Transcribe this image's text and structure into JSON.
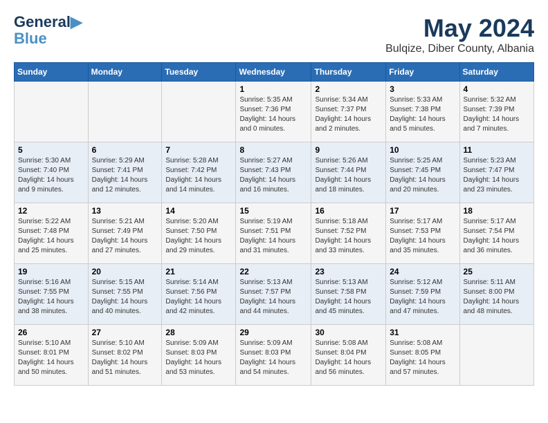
{
  "logo": {
    "line1": "General",
    "line2": "Blue"
  },
  "title": "May 2024",
  "location": "Bulqize, Diber County, Albania",
  "days_of_week": [
    "Sunday",
    "Monday",
    "Tuesday",
    "Wednesday",
    "Thursday",
    "Friday",
    "Saturday"
  ],
  "weeks": [
    [
      {
        "day": "",
        "info": ""
      },
      {
        "day": "",
        "info": ""
      },
      {
        "day": "",
        "info": ""
      },
      {
        "day": "1",
        "info": "Sunrise: 5:35 AM\nSunset: 7:36 PM\nDaylight: 14 hours\nand 0 minutes."
      },
      {
        "day": "2",
        "info": "Sunrise: 5:34 AM\nSunset: 7:37 PM\nDaylight: 14 hours\nand 2 minutes."
      },
      {
        "day": "3",
        "info": "Sunrise: 5:33 AM\nSunset: 7:38 PM\nDaylight: 14 hours\nand 5 minutes."
      },
      {
        "day": "4",
        "info": "Sunrise: 5:32 AM\nSunset: 7:39 PM\nDaylight: 14 hours\nand 7 minutes."
      }
    ],
    [
      {
        "day": "5",
        "info": "Sunrise: 5:30 AM\nSunset: 7:40 PM\nDaylight: 14 hours\nand 9 minutes."
      },
      {
        "day": "6",
        "info": "Sunrise: 5:29 AM\nSunset: 7:41 PM\nDaylight: 14 hours\nand 12 minutes."
      },
      {
        "day": "7",
        "info": "Sunrise: 5:28 AM\nSunset: 7:42 PM\nDaylight: 14 hours\nand 14 minutes."
      },
      {
        "day": "8",
        "info": "Sunrise: 5:27 AM\nSunset: 7:43 PM\nDaylight: 14 hours\nand 16 minutes."
      },
      {
        "day": "9",
        "info": "Sunrise: 5:26 AM\nSunset: 7:44 PM\nDaylight: 14 hours\nand 18 minutes."
      },
      {
        "day": "10",
        "info": "Sunrise: 5:25 AM\nSunset: 7:45 PM\nDaylight: 14 hours\nand 20 minutes."
      },
      {
        "day": "11",
        "info": "Sunrise: 5:23 AM\nSunset: 7:47 PM\nDaylight: 14 hours\nand 23 minutes."
      }
    ],
    [
      {
        "day": "12",
        "info": "Sunrise: 5:22 AM\nSunset: 7:48 PM\nDaylight: 14 hours\nand 25 minutes."
      },
      {
        "day": "13",
        "info": "Sunrise: 5:21 AM\nSunset: 7:49 PM\nDaylight: 14 hours\nand 27 minutes."
      },
      {
        "day": "14",
        "info": "Sunrise: 5:20 AM\nSunset: 7:50 PM\nDaylight: 14 hours\nand 29 minutes."
      },
      {
        "day": "15",
        "info": "Sunrise: 5:19 AM\nSunset: 7:51 PM\nDaylight: 14 hours\nand 31 minutes."
      },
      {
        "day": "16",
        "info": "Sunrise: 5:18 AM\nSunset: 7:52 PM\nDaylight: 14 hours\nand 33 minutes."
      },
      {
        "day": "17",
        "info": "Sunrise: 5:17 AM\nSunset: 7:53 PM\nDaylight: 14 hours\nand 35 minutes."
      },
      {
        "day": "18",
        "info": "Sunrise: 5:17 AM\nSunset: 7:54 PM\nDaylight: 14 hours\nand 36 minutes."
      }
    ],
    [
      {
        "day": "19",
        "info": "Sunrise: 5:16 AM\nSunset: 7:55 PM\nDaylight: 14 hours\nand 38 minutes."
      },
      {
        "day": "20",
        "info": "Sunrise: 5:15 AM\nSunset: 7:55 PM\nDaylight: 14 hours\nand 40 minutes."
      },
      {
        "day": "21",
        "info": "Sunrise: 5:14 AM\nSunset: 7:56 PM\nDaylight: 14 hours\nand 42 minutes."
      },
      {
        "day": "22",
        "info": "Sunrise: 5:13 AM\nSunset: 7:57 PM\nDaylight: 14 hours\nand 44 minutes."
      },
      {
        "day": "23",
        "info": "Sunrise: 5:13 AM\nSunset: 7:58 PM\nDaylight: 14 hours\nand 45 minutes."
      },
      {
        "day": "24",
        "info": "Sunrise: 5:12 AM\nSunset: 7:59 PM\nDaylight: 14 hours\nand 47 minutes."
      },
      {
        "day": "25",
        "info": "Sunrise: 5:11 AM\nSunset: 8:00 PM\nDaylight: 14 hours\nand 48 minutes."
      }
    ],
    [
      {
        "day": "26",
        "info": "Sunrise: 5:10 AM\nSunset: 8:01 PM\nDaylight: 14 hours\nand 50 minutes."
      },
      {
        "day": "27",
        "info": "Sunrise: 5:10 AM\nSunset: 8:02 PM\nDaylight: 14 hours\nand 51 minutes."
      },
      {
        "day": "28",
        "info": "Sunrise: 5:09 AM\nSunset: 8:03 PM\nDaylight: 14 hours\nand 53 minutes."
      },
      {
        "day": "29",
        "info": "Sunrise: 5:09 AM\nSunset: 8:03 PM\nDaylight: 14 hours\nand 54 minutes."
      },
      {
        "day": "30",
        "info": "Sunrise: 5:08 AM\nSunset: 8:04 PM\nDaylight: 14 hours\nand 56 minutes."
      },
      {
        "day": "31",
        "info": "Sunrise: 5:08 AM\nSunset: 8:05 PM\nDaylight: 14 hours\nand 57 minutes."
      },
      {
        "day": "",
        "info": ""
      }
    ]
  ]
}
